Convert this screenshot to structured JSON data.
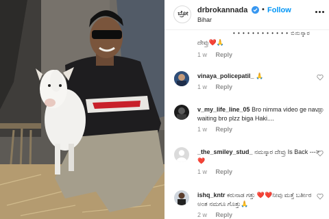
{
  "post": {
    "username": "drbrokannada",
    "follow_label": "Follow",
    "dot": "•",
    "location": "Bihar",
    "avatar_text": "ಬ್ರೋ"
  },
  "comments": {
    "partial": {
      "top_text": "• • • • • • • • • • • • ಬಿನುಸ್ಕಾರ",
      "line_text": "ದೇವ್ರು❤️🙏",
      "time": "1 w",
      "reply_label": "Reply"
    },
    "items": [
      {
        "username": "vinaya_policepatil_",
        "text": "🙏",
        "time": "1 w",
        "reply_label": "Reply"
      },
      {
        "username": "v_my_life_line_05",
        "text": "Bro nimma video ge navu waiting bro plzz biga Haki....",
        "time": "1 w",
        "reply_label": "Reply"
      },
      {
        "username": "_the_smiley_stud_",
        "text": "ನಮಸ್ಕಾರ ದೇವ್ರು Is Back ---> ❤️",
        "time": "1 w",
        "reply_label": "Reply"
      },
      {
        "username": "ishq_kntr",
        "text": "ಕರುನಾಡ ಗತ್ತು ❤️❤️ನೀವು ಮತ್ತೆ ಬರ್ತೀರ ಅಂತ ನಮಗೂ ಗೊತ್ತು🙏",
        "time": "2 w",
        "reply_label": "Reply"
      }
    ]
  },
  "colors": {
    "follow": "#0095f6",
    "verified": "#3897f0",
    "meta": "#8e8e8e"
  }
}
